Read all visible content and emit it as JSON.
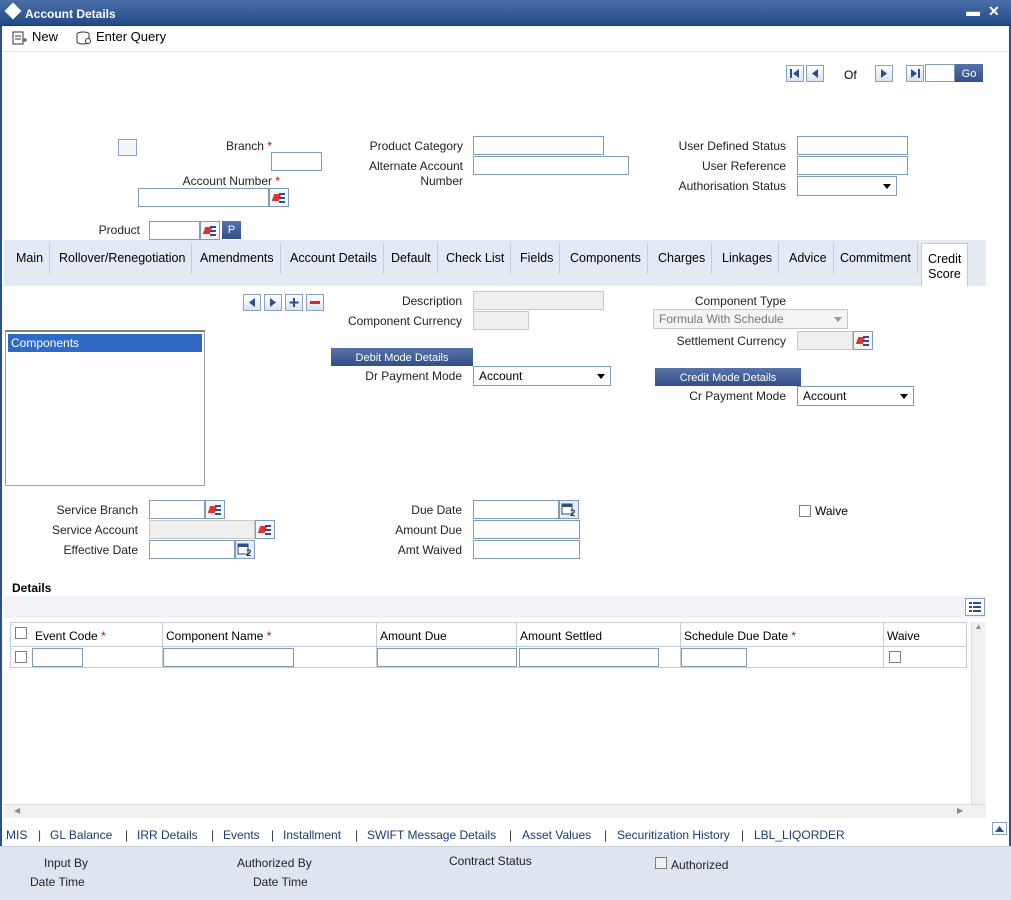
{
  "window": {
    "title": "Account Details"
  },
  "toolbar": {
    "new_label": "New",
    "query_label": "Enter Query"
  },
  "pager": {
    "of_label": "Of",
    "go_label": "Go"
  },
  "header": {
    "branch_label": "Branch",
    "account_number_label": "Account Number",
    "product_label": "Product",
    "product_button": "P",
    "product_category_label": "Product Category",
    "alternate_account_label_1": "Alternate Account",
    "alternate_account_label_2": "Number",
    "user_defined_status_label": "User Defined Status",
    "user_reference_label": "User Reference",
    "authorisation_status_label": "Authorisation Status",
    "required_mark": "*"
  },
  "tabs": [
    "Main",
    "Rollover/Renegotiation",
    "Amendments",
    "Account Details",
    "Default",
    "Check List",
    "Fields",
    "Components",
    "Charges",
    "Linkages",
    "Advice",
    "Commitment"
  ],
  "active_tab": {
    "line1": "Credit",
    "line2": "Score"
  },
  "components": {
    "list_items": [
      "Components"
    ],
    "description_label": "Description",
    "component_currency_label": "Component Currency",
    "component_type_label": "Component Type",
    "component_type_value": "Formula With Schedule",
    "settlement_currency_label": "Settlement Currency",
    "debit_mode_button": "Debit Mode Details",
    "dr_payment_mode_label": "Dr Payment Mode",
    "dr_payment_mode_value": "Account",
    "credit_mode_button": "Credit Mode Details",
    "cr_payment_mode_label": "Cr Payment Mode",
    "cr_payment_mode_value": "Account",
    "service_branch_label": "Service Branch",
    "service_account_label": "Service Account",
    "effective_date_label": "Effective Date",
    "due_date_label": "Due Date",
    "amount_due_label": "Amount Due",
    "amt_waived_label": "Amt Waived",
    "waive_label": "Waive"
  },
  "details": {
    "title": "Details",
    "columns": [
      "Event Code",
      "Component Name",
      "Amount Due",
      "Amount Settled",
      "Schedule Due Date",
      "Waive"
    ]
  },
  "footer_links": [
    "MIS",
    "GL Balance",
    "IRR Details",
    "Events",
    "Installment",
    "SWIFT Message Details",
    "Asset Values",
    "Securitization History",
    "LBL_LIQORDER"
  ],
  "audit": {
    "input_by": "Input By",
    "date_time_1": "Date Time",
    "authorized_by": "Authorized By",
    "date_time_2": "Date Time",
    "contract_status": "Contract Status",
    "authorized": "Authorized"
  }
}
